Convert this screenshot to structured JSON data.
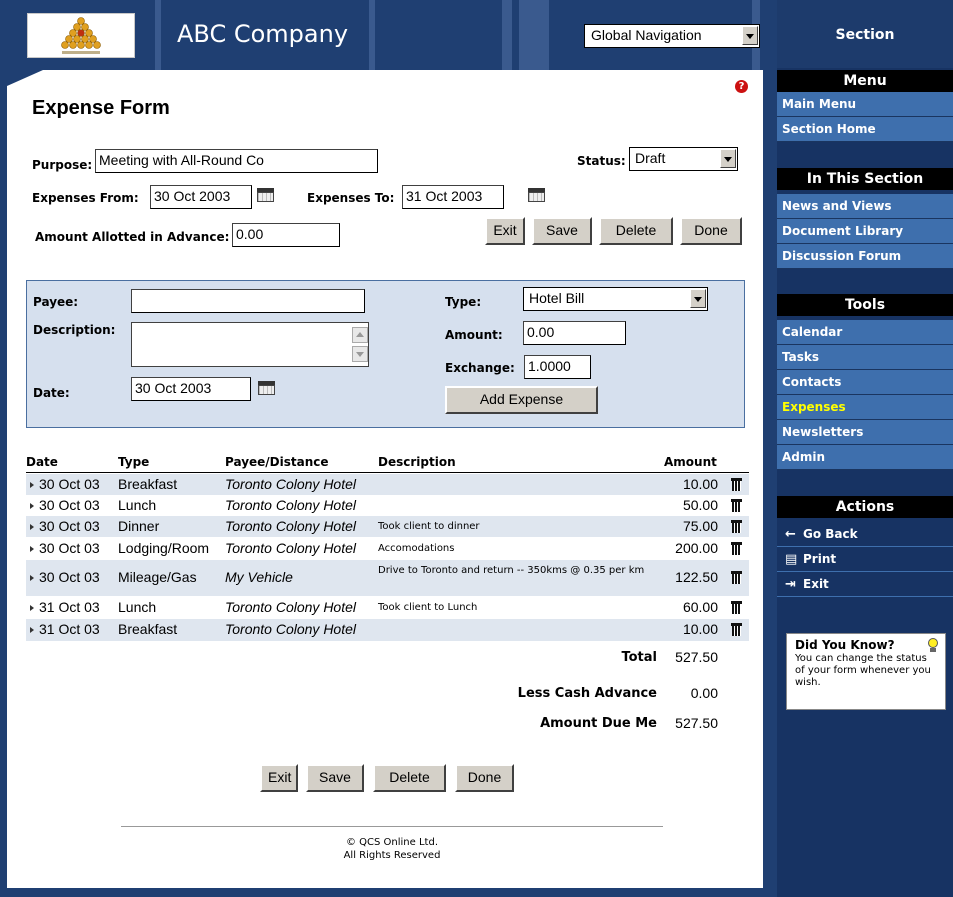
{
  "header": {
    "company": "ABC Company",
    "global_nav": {
      "selected": "Global Navigation"
    }
  },
  "sidebar": {
    "section_title": "Section",
    "menu": {
      "title": "Menu",
      "items": [
        "Main Menu",
        "Section Home"
      ]
    },
    "in_section": {
      "title": "In This Section",
      "items": [
        "News and Views",
        "Document Library",
        "Discussion Forum"
      ]
    },
    "tools": {
      "title": "Tools",
      "items": [
        "Calendar",
        "Tasks",
        "Contacts",
        "Expenses",
        "Newsletters",
        "Admin"
      ],
      "active": "Expenses"
    },
    "actions": {
      "title": "Actions",
      "items": [
        {
          "icon": "arrow-left-icon",
          "label": "Go Back"
        },
        {
          "icon": "printer-icon",
          "label": "Print"
        },
        {
          "icon": "exit-door-icon",
          "label": "Exit"
        }
      ]
    },
    "tip": {
      "title": "Did You Know?",
      "text": "You can change the status of your form whenever you wish."
    }
  },
  "form": {
    "title": "Expense Form",
    "purpose_label": "Purpose:",
    "purpose_value": "Meeting with All-Round Co",
    "status_label": "Status:",
    "status_value": "Draft",
    "from_label": "Expenses From:",
    "from_value": "30 Oct 2003",
    "to_label": "Expenses To:",
    "to_value": "31 Oct 2003",
    "advance_label": "Amount Allotted in Advance:",
    "advance_value": "0.00",
    "buttons": {
      "exit": "Exit",
      "save": "Save",
      "delete": "Delete",
      "done": "Done"
    }
  },
  "entry": {
    "payee_label": "Payee:",
    "payee_value": "",
    "description_label": "Description:",
    "description_value": "",
    "date_label": "Date:",
    "date_value": "30 Oct 2003",
    "type_label": "Type:",
    "type_value": "Hotel Bill",
    "amount_label": "Amount:",
    "amount_value": "0.00",
    "exchange_label": "Exchange:",
    "exchange_value": "1.0000",
    "add_button": "Add Expense"
  },
  "table": {
    "headers": {
      "date": "Date",
      "type": "Type",
      "payee": "Payee/Distance",
      "description": "Description",
      "amount": "Amount"
    },
    "rows": [
      {
        "date": "30 Oct 03",
        "type": "Breakfast",
        "payee": "Toronto Colony Hotel",
        "description": "",
        "amount": "10.00"
      },
      {
        "date": "30 Oct 03",
        "type": "Lunch",
        "payee": "Toronto Colony Hotel",
        "description": "",
        "amount": "50.00"
      },
      {
        "date": "30 Oct 03",
        "type": "Dinner",
        "payee": "Toronto Colony Hotel",
        "description": "Took client to dinner",
        "amount": "75.00"
      },
      {
        "date": "30 Oct 03",
        "type": "Lodging/Room",
        "payee": "Toronto Colony Hotel",
        "description": "Accomodations",
        "amount": "200.00"
      },
      {
        "date": "30 Oct 03",
        "type": "Mileage/Gas",
        "payee": "My Vehicle",
        "description": "Drive to Toronto and return -- 350kms @ 0.35 per km",
        "amount": "122.50"
      },
      {
        "date": "31 Oct 03",
        "type": "Lunch",
        "payee": "Toronto Colony Hotel",
        "description": "Took client to Lunch",
        "amount": "60.00"
      },
      {
        "date": "31 Oct 03",
        "type": "Breakfast",
        "payee": "Toronto Colony Hotel",
        "description": "",
        "amount": "10.00"
      }
    ],
    "totals": {
      "total_label": "Total",
      "total_value": "527.50",
      "advance_label": "Less Cash Advance",
      "advance_value": "0.00",
      "due_label": "Amount Due Me",
      "due_value": "527.50"
    }
  },
  "footer": {
    "line1": "© QCS Online Ltd.",
    "line2": "All Rights Reserved"
  }
}
